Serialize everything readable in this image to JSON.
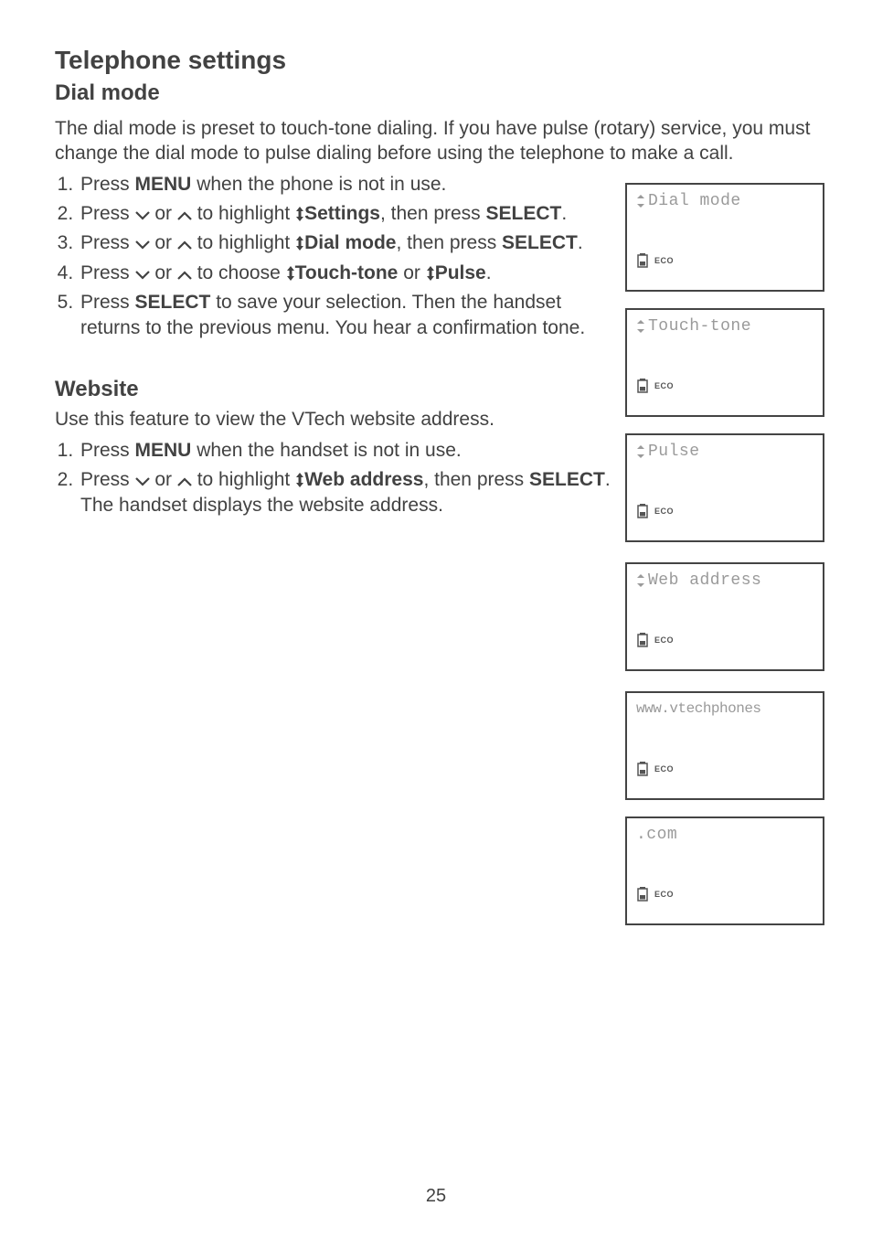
{
  "main_title": "Telephone settings",
  "sub_title": "Dial mode",
  "intro": "The dial mode is preset to touch-tone dialing. If you have pulse (rotary) service, you must change the dial mode to pulse dialing before using the telephone to make a call.",
  "steps_dial": {
    "s1a": "Press ",
    "s1_menu": "MENU",
    "s1b": " when the phone is not in use.",
    "s2a": "Press ",
    "s2_or": " or ",
    "s2b": " to highlight ",
    "s2_opt": "Settings",
    "s2c": ", then press ",
    "s2_sel": "SELECT",
    "s2d": ".",
    "s3a": "Press ",
    "s3_or": " or ",
    "s3b": " to highlight ",
    "s3_opt": "Dial mode",
    "s3c": ", then press ",
    "s3_sel": "SELECT",
    "s3d": ".",
    "s4a": "Press ",
    "s4_or": " or ",
    "s4b": " to choose ",
    "s4_opt1": "Touch-tone",
    "s4_mid": " or ",
    "s4_opt2": "Pulse",
    "s4d": ".",
    "s5a": "Press ",
    "s5_sel": "SELECT",
    "s5b": " to save your selection. Then the handset returns to the previous menu. You hear a confirmation tone."
  },
  "website_title": "Website",
  "website_intro": "Use this feature to view the VTech website address.",
  "steps_web": {
    "s1a": "Press ",
    "s1_menu": "MENU",
    "s1b": " when the handset is not in use.",
    "s2a": "Press ",
    "s2_or": " or ",
    "s2b": " to highlight ",
    "s2_opt": "Web address",
    "s2c": ", then press ",
    "s2_sel": "SELECT",
    "s2d": ". The handset displays the website address."
  },
  "lcd": {
    "eco": "ECO",
    "n1": "Dial mode",
    "n2": "Touch-tone",
    "n3": "Pulse",
    "n4": "Web address",
    "n5": "www.vtechphones",
    "n6": ".com"
  },
  "page_number": "25"
}
